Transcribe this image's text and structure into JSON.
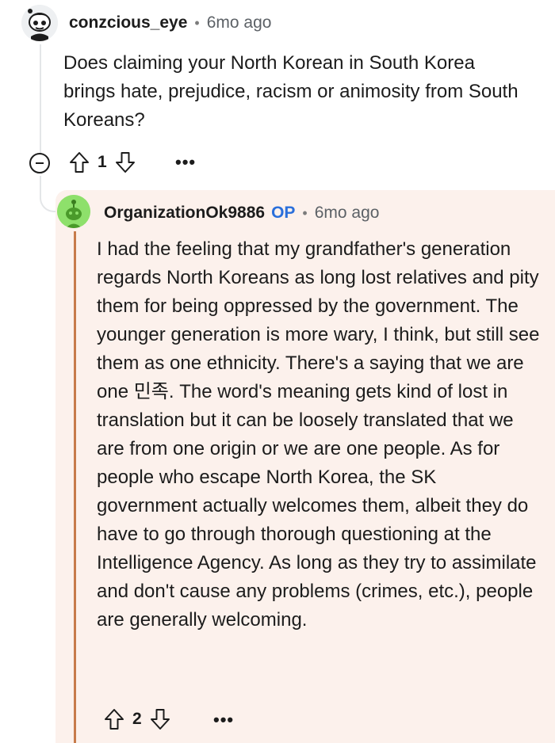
{
  "parent_comment": {
    "username": "conzcious_eye",
    "separator": "•",
    "timestamp": "6mo ago",
    "body": "Does claiming your North Korean in South Korea brings hate, prejudice, racism or animosity from South Koreans?",
    "score": "1",
    "more_label": "•••",
    "avatar_icon": "snoo-avatar-icon"
  },
  "reply_comment": {
    "username": "OrganizationOk9886",
    "op_badge": "OP",
    "separator": "•",
    "timestamp": "6mo ago",
    "body": "I had the feeling that my grandfather's generation regards North Koreans as long lost relatives and pity them for being oppressed by the government. The younger generation is more wary, I think, but still see them as one ethnicity. There's a saying that we are one 민족. The word's meaning gets kind of lost in translation but it can be loosely translated that we are from one origin or we are one people. As for people who escape North Korea, the SK government actually welcomes them, albeit they do have to go through thorough questioning at the Intelligence Agency. As long as they try to assimilate and don't cause any problems (crimes, etc.), people are generally welcoming.",
    "score": "2",
    "more_label": "•••",
    "avatar_icon": "snoo-avatar-icon",
    "highlight_color": "#fcf1ec",
    "accent_color": "#c77b4b",
    "op_color": "#2a6fdb"
  }
}
